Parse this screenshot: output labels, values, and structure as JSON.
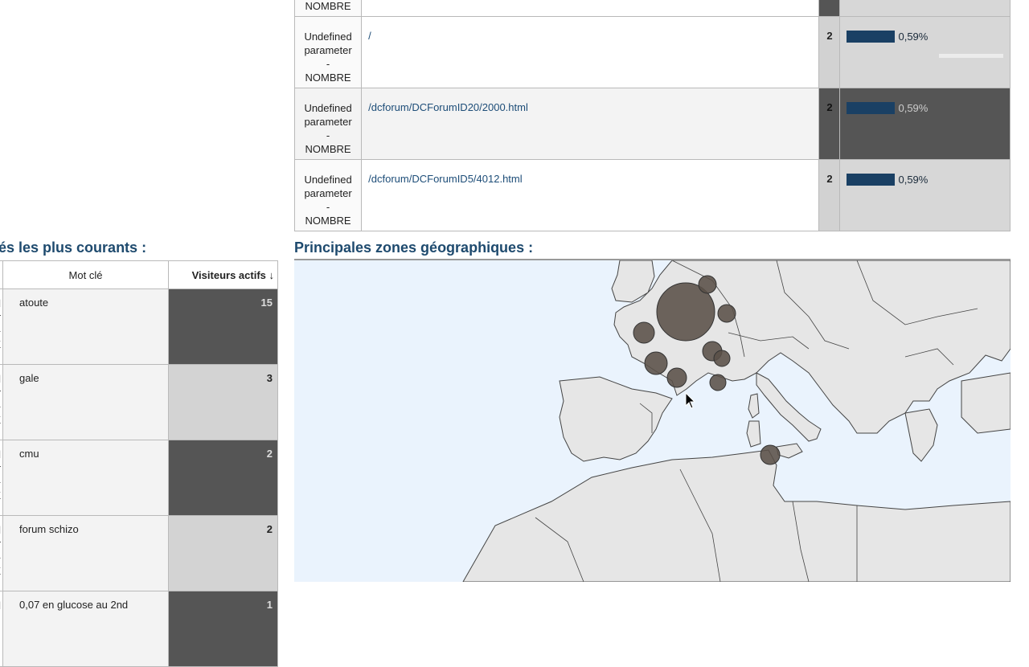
{
  "pages_table": {
    "top_row_partial_label": "NOMBRE",
    "rows": [
      {
        "dimension": [
          "Undefined",
          "parameter",
          "-",
          "NOMBRE"
        ],
        "page": "/",
        "visitors": "2",
        "percent": "0,59%",
        "shaded": false
      },
      {
        "dimension": [
          "Undefined",
          "parameter",
          "-",
          "NOMBRE"
        ],
        "page": "/dcforum/DCForumID20/2000.html",
        "visitors": "2",
        "percent": "0,59%",
        "shaded": true
      },
      {
        "dimension": [
          "Undefined",
          "parameter",
          "-",
          "NOMBRE"
        ],
        "page": "/dcforum/DCForumID5/4012.html",
        "visitors": "2",
        "percent": "0,59%",
        "shaded": false
      }
    ],
    "bar_color": "#1a4064"
  },
  "keywords_section": {
    "title": "és les plus courants :",
    "col_keyword": "Mot clé",
    "col_visitors": "Visiteurs actifs ↓",
    "rows": [
      {
        "dim": [
          "d",
          "r",
          "-",
          "E"
        ],
        "keyword": "atoute",
        "value": "15",
        "dark": true
      },
      {
        "dim": [
          "d",
          "r",
          "-",
          "E"
        ],
        "keyword": "gale",
        "value": "3",
        "dark": false
      },
      {
        "dim": [
          "d",
          "r",
          "-",
          "E"
        ],
        "keyword": "cmu",
        "value": "2",
        "dark": true
      },
      {
        "dim": [
          "d",
          "r",
          "-",
          "E"
        ],
        "keyword": "forum schizo",
        "value": "2",
        "dark": false
      },
      {
        "dim": [
          "d"
        ],
        "keyword": "0,07 en glucose au 2nd",
        "value": "1",
        "dark": true
      }
    ]
  },
  "geo_section": {
    "title": "Principales zones géographiques :",
    "colors": {
      "sea": "#eaf3fd",
      "land": "#e6e6e6",
      "border": "#444444",
      "bubble": "#5a5048"
    },
    "bubbles": [
      {
        "name": "paris",
        "size": 36
      },
      {
        "name": "lille",
        "size": 11
      },
      {
        "name": "strasbourg",
        "size": 11
      },
      {
        "name": "rennes",
        "size": 13
      },
      {
        "name": "lyon",
        "size": 12
      },
      {
        "name": "grenoble",
        "size": 10
      },
      {
        "name": "bordeaux",
        "size": 14
      },
      {
        "name": "toulouse",
        "size": 12
      },
      {
        "name": "marseille",
        "size": 10
      },
      {
        "name": "tunis",
        "size": 12
      }
    ]
  }
}
